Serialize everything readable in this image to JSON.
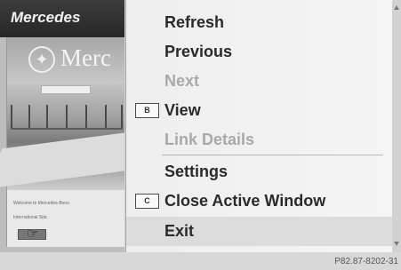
{
  "browser": {
    "brand": "Mercedes",
    "hero_word": "Merc",
    "tiny_line_1": "Welcome to Mercedes-Benz.",
    "tiny_line_2": "International Site.",
    "cursor_glyph": "☞"
  },
  "menu": {
    "items": [
      {
        "label": "Refresh",
        "enabled": true
      },
      {
        "label": "Previous",
        "enabled": true
      },
      {
        "label": "Next",
        "enabled": false
      },
      {
        "label": "View",
        "enabled": true,
        "icon": "B"
      },
      {
        "label": "Link Details",
        "enabled": false
      },
      {
        "label": "Settings",
        "enabled": true
      },
      {
        "label": "Close Active Window",
        "enabled": true,
        "icon": "C"
      },
      {
        "label": "Exit",
        "enabled": true,
        "selected": true
      }
    ]
  },
  "caption": "P82.87-8202-31"
}
